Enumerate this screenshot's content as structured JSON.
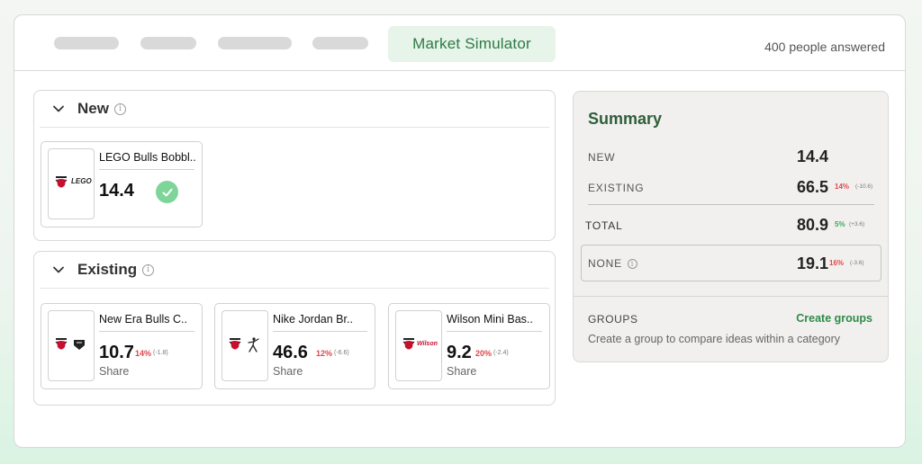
{
  "header": {
    "active_tab": "Market Simulator",
    "respondents": "400 people answered"
  },
  "sections": {
    "new": {
      "title": "New",
      "cards": [
        {
          "title": "LEGO Bulls Bobbl..",
          "value": "14.4",
          "brand": "LEGO"
        }
      ]
    },
    "existing": {
      "title": "Existing",
      "cards": [
        {
          "title": "New Era Bulls C..",
          "value": "10.7",
          "pct": "14%",
          "delta": "(-1.8)",
          "sub": "Share",
          "brand": "NE"
        },
        {
          "title": "Nike Jordan Br..",
          "value": "46.6",
          "pct": "12%",
          "delta": "(-6.6)",
          "sub": "Share",
          "brand": "jumpman"
        },
        {
          "title": "Wilson Mini Bas..",
          "value": "9.2",
          "pct": "20%",
          "delta": "(-2.4)",
          "sub": "Share",
          "brand": "Wilson"
        }
      ]
    }
  },
  "summary": {
    "title": "Summary",
    "rows": {
      "new": {
        "label": "NEW",
        "value": "14.4"
      },
      "existing": {
        "label": "EXISTING",
        "value": "66.5",
        "pct": "14%",
        "delta": "(-10.6)"
      },
      "total": {
        "label": "TOTAL",
        "value": "80.9",
        "pct": "5%",
        "delta": "(+3.6)"
      },
      "none": {
        "label": "NONE",
        "value": "19.1",
        "pct": "16%",
        "delta": "(-3.6)"
      }
    },
    "groups": {
      "label": "GROUPS",
      "action": "Create groups",
      "description": "Create a group to compare ideas within a category"
    }
  },
  "colors": {
    "accent_green": "#2f7a44",
    "negative_red": "#e0464b",
    "positive_green": "#3aa860",
    "check_green": "#7dd59a"
  }
}
